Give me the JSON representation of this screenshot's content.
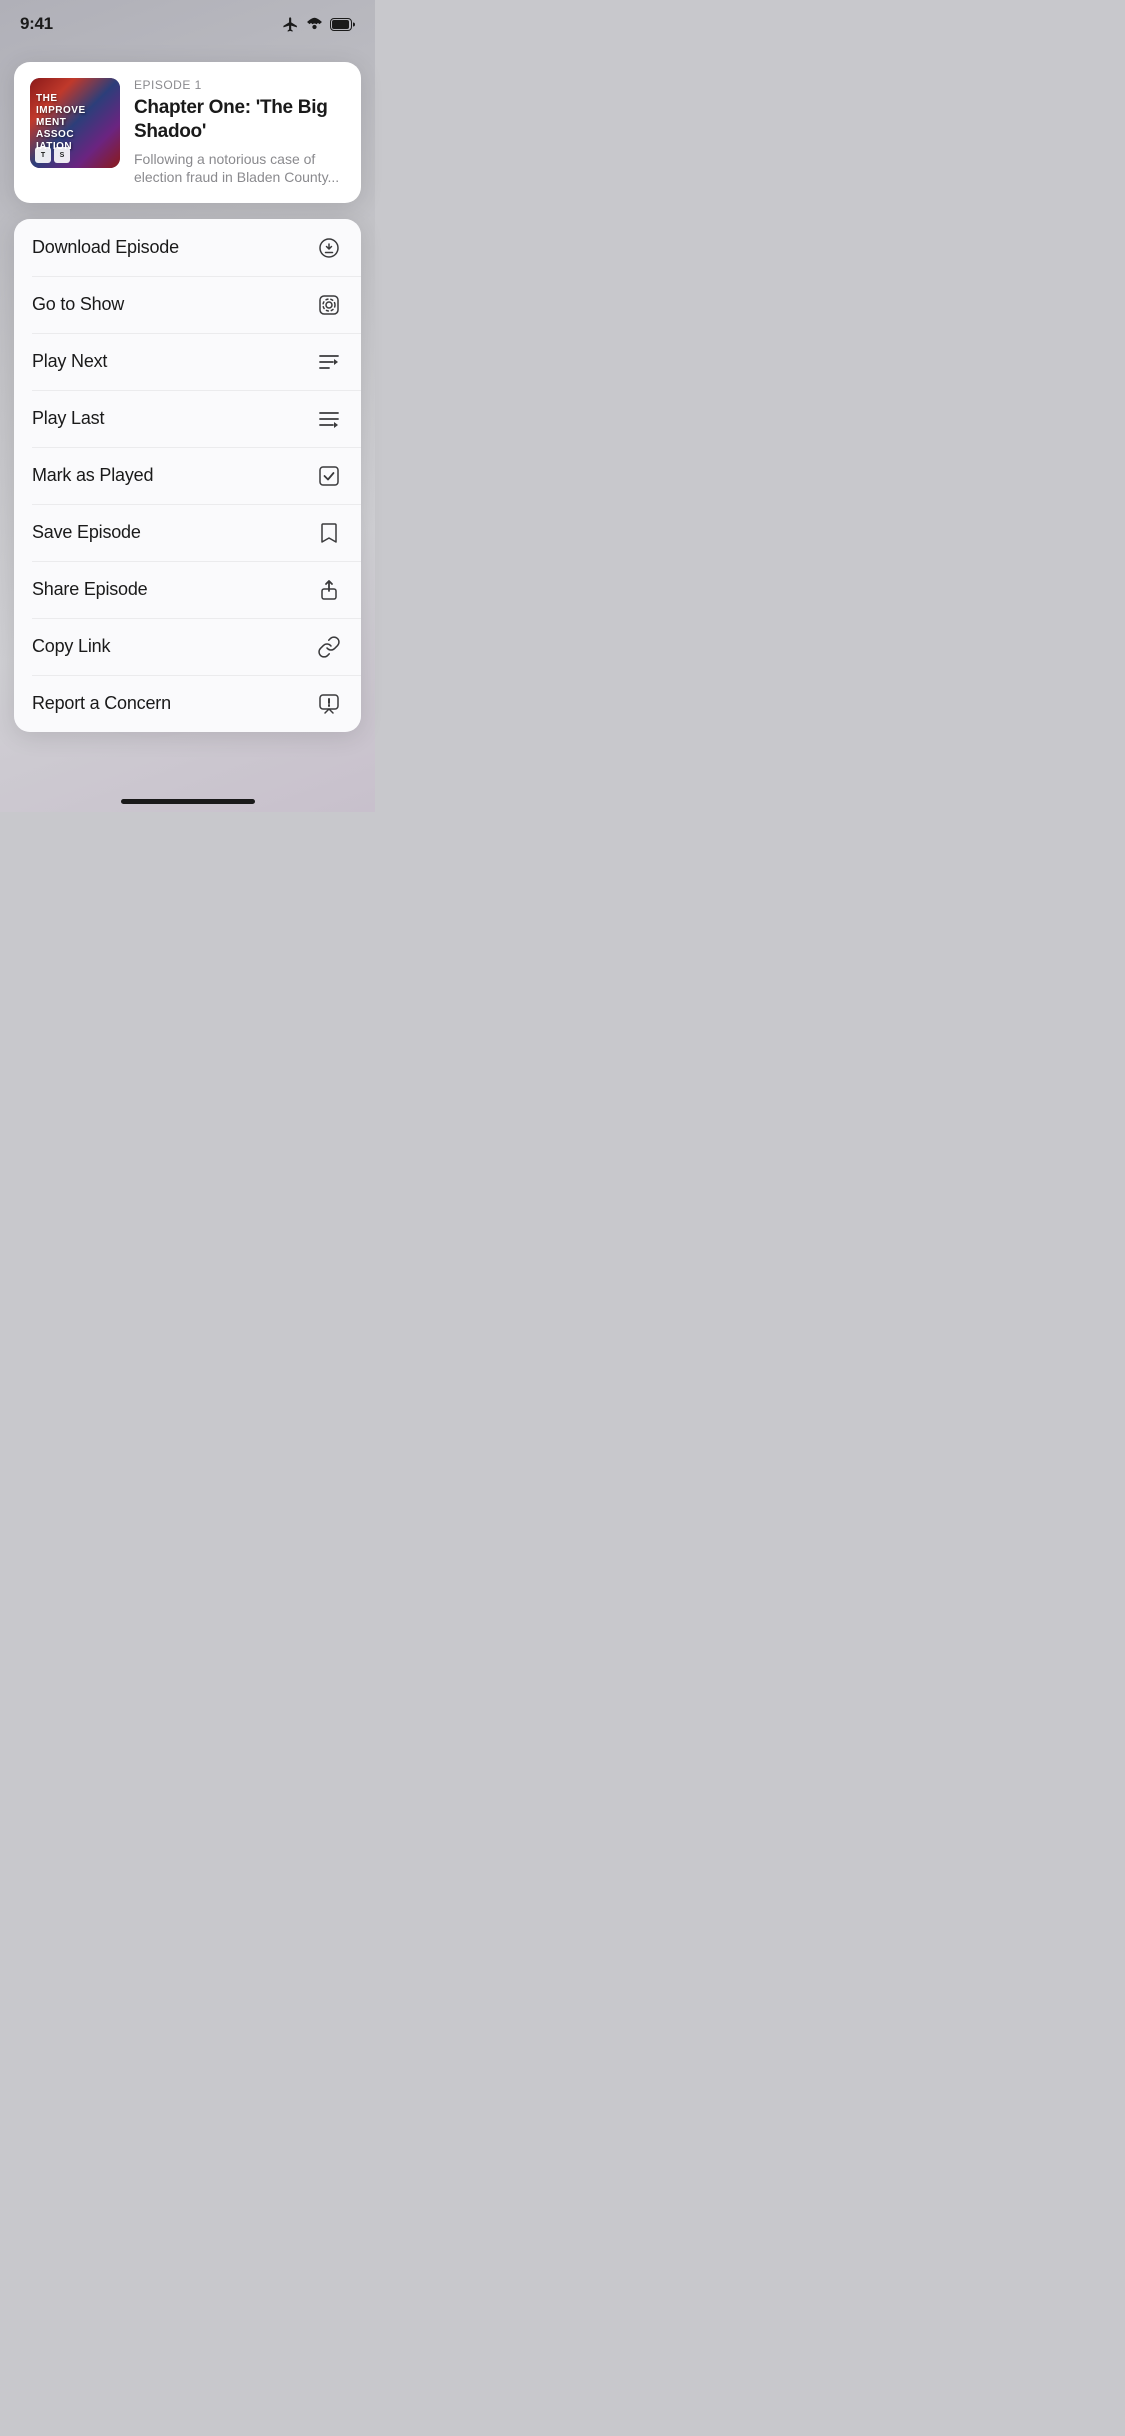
{
  "statusBar": {
    "time": "9:41"
  },
  "episodeCard": {
    "episodeLabel": "EPISODE 1",
    "episodeTitle": "Chapter One: 'The Big Shadoo'",
    "episodeDesc": "Following a notorious case of election fraud in Bladen County...",
    "artworkLines": [
      "THE",
      "IMPROVE",
      "MENT",
      "ASSOC",
      "IATION"
    ],
    "logo1": "T",
    "logo2": "S"
  },
  "contextMenu": {
    "items": [
      {
        "id": "download-episode",
        "label": "Download Episode",
        "icon": "download"
      },
      {
        "id": "go-to-show",
        "label": "Go to Show",
        "icon": "podcast"
      },
      {
        "id": "play-next",
        "label": "Play Next",
        "icon": "play-next"
      },
      {
        "id": "play-last",
        "label": "Play Last",
        "icon": "play-last"
      },
      {
        "id": "mark-as-played",
        "label": "Mark as Played",
        "icon": "checkmark"
      },
      {
        "id": "save-episode",
        "label": "Save Episode",
        "icon": "bookmark"
      },
      {
        "id": "share-episode",
        "label": "Share Episode",
        "icon": "share"
      },
      {
        "id": "copy-link",
        "label": "Copy Link",
        "icon": "link"
      },
      {
        "id": "report-concern",
        "label": "Report a Concern",
        "icon": "report"
      }
    ]
  }
}
